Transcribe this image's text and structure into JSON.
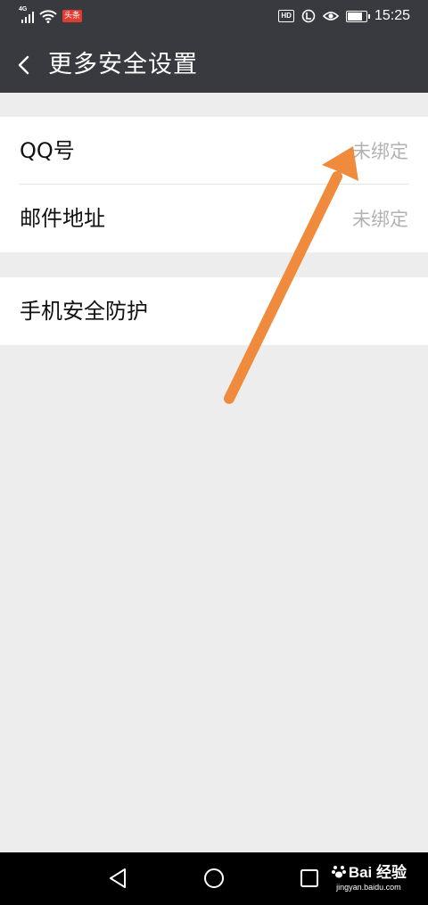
{
  "status_bar": {
    "network_type": "4G",
    "app_badge": "头条",
    "hd_label": "HD",
    "time": "15:25",
    "battery_level": 0.85
  },
  "header": {
    "title": "更多安全设置",
    "back_icon": "chevron-left-icon"
  },
  "settings": {
    "groups": [
      {
        "items": [
          {
            "label": "QQ号",
            "value": "未绑定"
          },
          {
            "label": "邮件地址",
            "value": "未绑定"
          }
        ]
      },
      {
        "items": [
          {
            "label": "手机安全防护"
          }
        ]
      }
    ]
  },
  "annotation": {
    "arrow_color": "#f08a3c",
    "points_to": "QQ号 value"
  },
  "nav_bar": {
    "back_icon": "triangle-back-icon",
    "home_icon": "circle-home-icon",
    "recents_icon": "square-recents-icon"
  },
  "watermark": {
    "brand": "Bai 经验",
    "url": "jingyan.baidu.com"
  },
  "colors": {
    "header_bg": "#393a3f",
    "page_bg": "#ededed",
    "secondary_text": "#b2b2b2"
  }
}
